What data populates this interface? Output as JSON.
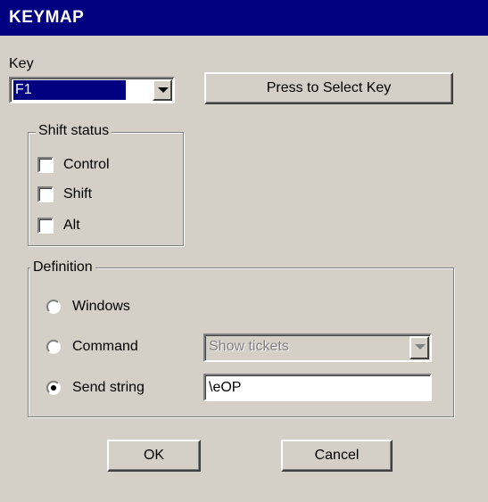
{
  "window": {
    "title": "KEYMAP"
  },
  "key": {
    "label": "Key",
    "selected": "F1",
    "select_button": "Press to Select Key"
  },
  "shift_status": {
    "legend": "Shift status",
    "options": [
      {
        "label": "Control",
        "checked": false
      },
      {
        "label": "Shift",
        "checked": false
      },
      {
        "label": "Alt",
        "checked": false
      }
    ]
  },
  "definition": {
    "legend": "Definition",
    "options": [
      {
        "label": "Windows",
        "selected": false
      },
      {
        "label": "Command",
        "selected": false
      },
      {
        "label": "Send string",
        "selected": true
      }
    ],
    "command_value": "Show tickets",
    "send_string_value": "\\eOP"
  },
  "buttons": {
    "ok": "OK",
    "cancel": "Cancel"
  },
  "icons": {
    "dropdown": "chevron-down-icon"
  },
  "colors": {
    "titlebar": "#000080",
    "face": "#d4d0c8"
  }
}
